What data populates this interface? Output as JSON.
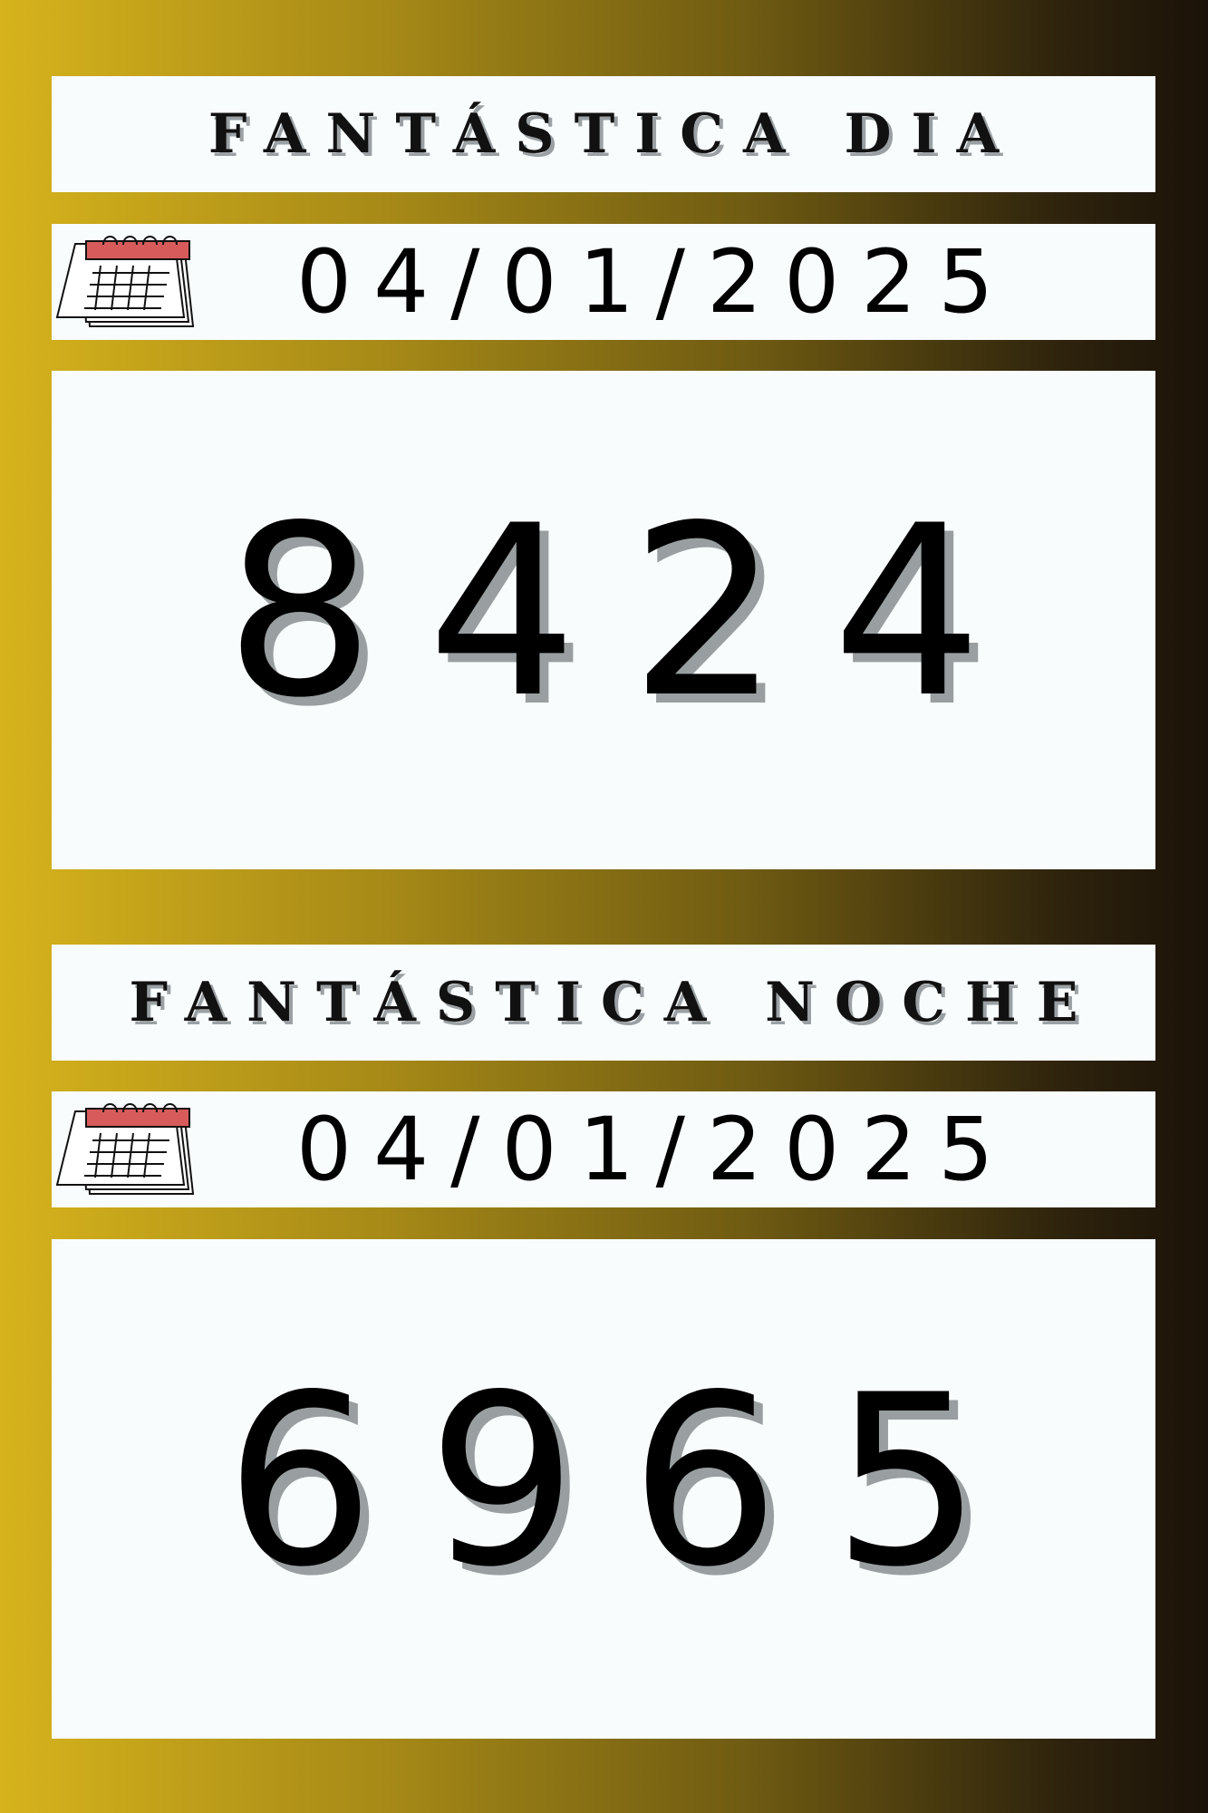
{
  "colors": {
    "background_left": "#d6b31c",
    "background_right": "#1b1209",
    "panel": "#f8fcfd",
    "text": "#000000",
    "shadow": "#999fa1",
    "calendar_accent": "#d85b5b"
  },
  "icons": {
    "calendar": "calendar-icon"
  },
  "sections": [
    {
      "title": "FANTÁSTICA DIA",
      "date": "04/01/2025",
      "number": "8424"
    },
    {
      "title": "FANTÁSTICA NOCHE",
      "date": "04/01/2025",
      "number": "6965"
    }
  ]
}
